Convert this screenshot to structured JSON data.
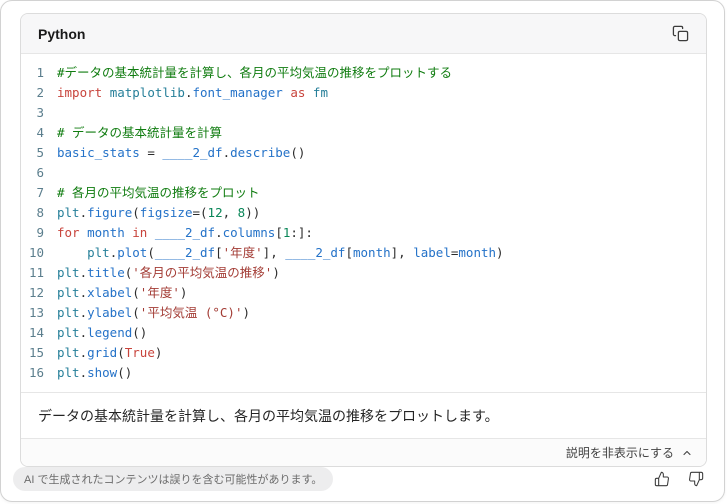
{
  "header": {
    "language_label": "Python",
    "copy_icon": "copy-icon"
  },
  "code": {
    "lines": [
      [
        {
          "c": "c",
          "x": "#データの基本統計量を計算し、各月の平均気温の推移をプロットする"
        }
      ],
      [
        {
          "c": "k",
          "x": "import"
        },
        {
          "c": "p",
          "x": " "
        },
        {
          "c": "m",
          "x": "matplotlib"
        },
        {
          "c": "p",
          "x": "."
        },
        {
          "c": "v",
          "x": "font_manager"
        },
        {
          "c": "p",
          "x": " "
        },
        {
          "c": "k",
          "x": "as"
        },
        {
          "c": "p",
          "x": " "
        },
        {
          "c": "m",
          "x": "fm"
        }
      ],
      [],
      [
        {
          "c": "c",
          "x": "# データの基本統計量を計算"
        }
      ],
      [
        {
          "c": "v",
          "x": "basic_stats"
        },
        {
          "c": "p",
          "x": " = "
        },
        {
          "c": "v",
          "x": "____2_df"
        },
        {
          "c": "p",
          "x": "."
        },
        {
          "c": "v",
          "x": "describe"
        },
        {
          "c": "p",
          "x": "()"
        }
      ],
      [],
      [
        {
          "c": "c",
          "x": "# 各月の平均気温の推移をプロット"
        }
      ],
      [
        {
          "c": "m",
          "x": "plt"
        },
        {
          "c": "p",
          "x": "."
        },
        {
          "c": "v",
          "x": "figure"
        },
        {
          "c": "p",
          "x": "("
        },
        {
          "c": "v",
          "x": "figsize"
        },
        {
          "c": "p",
          "x": "=("
        },
        {
          "c": "n",
          "x": "12"
        },
        {
          "c": "p",
          "x": ", "
        },
        {
          "c": "n",
          "x": "8"
        },
        {
          "c": "p",
          "x": "))"
        }
      ],
      [
        {
          "c": "k",
          "x": "for"
        },
        {
          "c": "p",
          "x": " "
        },
        {
          "c": "v",
          "x": "month"
        },
        {
          "c": "p",
          "x": " "
        },
        {
          "c": "k",
          "x": "in"
        },
        {
          "c": "p",
          "x": " "
        },
        {
          "c": "v",
          "x": "____2_df"
        },
        {
          "c": "p",
          "x": "."
        },
        {
          "c": "v",
          "x": "columns"
        },
        {
          "c": "p",
          "x": "["
        },
        {
          "c": "n",
          "x": "1"
        },
        {
          "c": "p",
          "x": ":]:"
        }
      ],
      [
        {
          "c": "p",
          "x": "    "
        },
        {
          "c": "m",
          "x": "plt"
        },
        {
          "c": "p",
          "x": "."
        },
        {
          "c": "v",
          "x": "plot"
        },
        {
          "c": "p",
          "x": "("
        },
        {
          "c": "v",
          "x": "____2_df"
        },
        {
          "c": "p",
          "x": "["
        },
        {
          "c": "s",
          "x": "'年度'"
        },
        {
          "c": "p",
          "x": "], "
        },
        {
          "c": "v",
          "x": "____2_df"
        },
        {
          "c": "p",
          "x": "["
        },
        {
          "c": "v",
          "x": "month"
        },
        {
          "c": "p",
          "x": "], "
        },
        {
          "c": "v",
          "x": "label"
        },
        {
          "c": "p",
          "x": "="
        },
        {
          "c": "v",
          "x": "month"
        },
        {
          "c": "p",
          "x": ")"
        }
      ],
      [
        {
          "c": "m",
          "x": "plt"
        },
        {
          "c": "p",
          "x": "."
        },
        {
          "c": "v",
          "x": "title"
        },
        {
          "c": "p",
          "x": "("
        },
        {
          "c": "s",
          "x": "'各月の平均気温の推移'"
        },
        {
          "c": "p",
          "x": ")"
        }
      ],
      [
        {
          "c": "m",
          "x": "plt"
        },
        {
          "c": "p",
          "x": "."
        },
        {
          "c": "v",
          "x": "xlabel"
        },
        {
          "c": "p",
          "x": "("
        },
        {
          "c": "s",
          "x": "'年度'"
        },
        {
          "c": "p",
          "x": ")"
        }
      ],
      [
        {
          "c": "m",
          "x": "plt"
        },
        {
          "c": "p",
          "x": "."
        },
        {
          "c": "v",
          "x": "ylabel"
        },
        {
          "c": "p",
          "x": "("
        },
        {
          "c": "s",
          "x": "'平均気温 (°C)'"
        },
        {
          "c": "p",
          "x": ")"
        }
      ],
      [
        {
          "c": "m",
          "x": "plt"
        },
        {
          "c": "p",
          "x": "."
        },
        {
          "c": "v",
          "x": "legend"
        },
        {
          "c": "p",
          "x": "()"
        }
      ],
      [
        {
          "c": "m",
          "x": "plt"
        },
        {
          "c": "p",
          "x": "."
        },
        {
          "c": "v",
          "x": "grid"
        },
        {
          "c": "p",
          "x": "("
        },
        {
          "c": "k",
          "x": "True"
        },
        {
          "c": "p",
          "x": ")"
        }
      ],
      [
        {
          "c": "m",
          "x": "plt"
        },
        {
          "c": "p",
          "x": "."
        },
        {
          "c": "v",
          "x": "show"
        },
        {
          "c": "p",
          "x": "()"
        }
      ]
    ]
  },
  "caption": {
    "text": "データの基本統計量を計算し、各月の平均気温の推移をプロットします。"
  },
  "explain_toggle": {
    "label": "説明を非表示にする",
    "icon": "chevron-up-icon"
  },
  "disclaimer": {
    "text": "AI で生成されたコンテンツは誤りを含む可能性があります。"
  },
  "feedback": {
    "thumbs_up_icon": "thumbs-up-icon",
    "thumbs_down_icon": "thumbs-down-icon"
  },
  "colors": {
    "keyword": "#c8443c",
    "string": "#a33c35",
    "module": "#267f99",
    "identifier": "#2472c8",
    "number": "#098658",
    "comment": "#107c10",
    "line_number": "#5b7e8d"
  }
}
